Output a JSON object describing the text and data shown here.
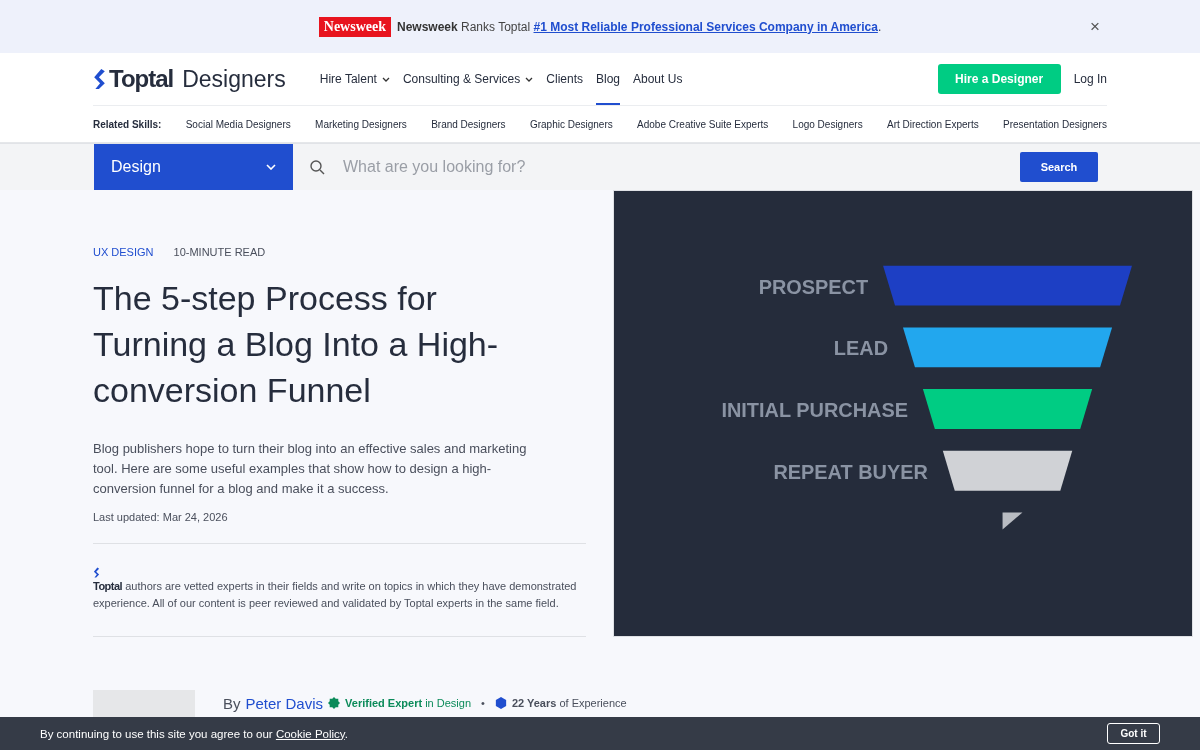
{
  "announcement": {
    "badge": "Newsweek",
    "lead": "Newsweek",
    "text": " Ranks Toptal ",
    "link": "#1 Most Reliable Professional Services Company in America",
    "tail": ".",
    "close": "×"
  },
  "header": {
    "logo": "Toptal",
    "logo_sub": "Designers",
    "nav": [
      {
        "label": "Hire Talent",
        "dropdown": true,
        "selected": false
      },
      {
        "label": "Consulting & Services",
        "dropdown": true,
        "selected": false
      },
      {
        "label": "Clients",
        "dropdown": false,
        "selected": false
      },
      {
        "label": "Blog",
        "dropdown": false,
        "selected": true
      },
      {
        "label": "About Us",
        "dropdown": false,
        "selected": false
      }
    ],
    "cta": "Hire a Designer",
    "login": "Log In"
  },
  "skills": {
    "label": "Related Skills:",
    "items": [
      "Social Media Designers",
      "Marketing Designers",
      "Brand Designers",
      "Graphic Designers",
      "Adobe Creative Suite Experts",
      "Logo Designers",
      "Art Direction Experts",
      "Presentation Designers"
    ]
  },
  "search": {
    "category": "Design",
    "placeholder": "What are you looking for?",
    "button": "Search"
  },
  "article": {
    "category": "UX DESIGN",
    "read_time": "10-MINUTE READ",
    "title": "The 5-step Process for Turning a Blog Into a High-conversion Funnel",
    "summary": "Blog publishers hope to turn their blog into an effective sales and marketing tool. Here are some useful examples that show how to design a high-conversion funnel for a blog and make it a success.",
    "updated": "Last updated: Mar 24, 2026",
    "vetted_logo": "Toptal",
    "vetted_text": "authors are vetted experts in their fields and write on topics in which they have demonstrated experience. All of our content is peer reviewed and validated by Toptal experts in the same field."
  },
  "hero": {
    "stages": [
      {
        "label": "PROSPECT",
        "color": "#1d3fc4"
      },
      {
        "label": "LEAD",
        "color": "#22a7ee"
      },
      {
        "label": "INITIAL PURCHASE",
        "color": "#00cc83"
      },
      {
        "label": "REPEAT BUYER",
        "color": "#d0d2d6"
      }
    ]
  },
  "author": {
    "by": "By",
    "name": "Peter Davis",
    "verified": "Verified Expert",
    "verified_in": " in Design",
    "dot": "•",
    "years": "22 Years",
    "years_tail": " of Experience"
  },
  "cookie": {
    "text": "By continuing to use this site you agree to our ",
    "link": "Cookie Policy",
    "tail": ".",
    "button": "Got it"
  }
}
